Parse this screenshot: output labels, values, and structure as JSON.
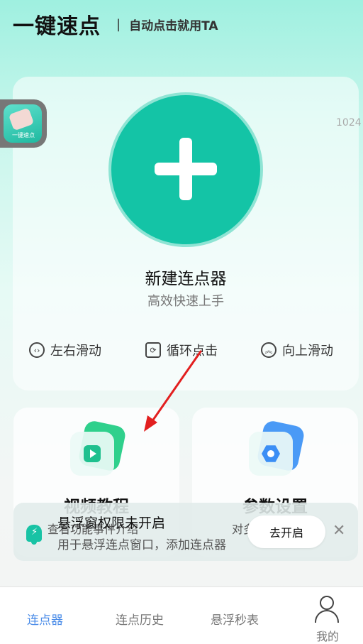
{
  "header": {
    "app_title": "一键速点",
    "separator": "|",
    "slogan": "自动点击就用TA"
  },
  "floating_app": {
    "label": "一键速点"
  },
  "counter_text": "1024",
  "main_card": {
    "new_button_icon": "plus-icon",
    "title": "新建连点器",
    "subtitle": "高效快速上手",
    "modes": [
      {
        "label": "左右滑动",
        "icon": "swap-horizontal-icon"
      },
      {
        "label": "循环点击",
        "icon": "loop-icon"
      },
      {
        "label": "向上滑动",
        "icon": "double-chevron-up-icon"
      }
    ]
  },
  "cards": {
    "video": {
      "title": "视频教程",
      "icon": "play-icon",
      "colors": {
        "back": "#2fd08c",
        "front": "#1fc08e"
      }
    },
    "params": {
      "title": "参数设置",
      "icon": "gear-hex-icon",
      "colors": {
        "back": "#4a9af6",
        "front": "#3b8ef5"
      }
    }
  },
  "toast": {
    "partial_text_left": "查看功能事件介绍",
    "partial_text_right": "对多",
    "title": "悬浮窗权限未开启",
    "desc": "用于悬浮连点窗口，添加连点器",
    "button": "去开启",
    "close": "✕"
  },
  "tabs": [
    {
      "label": "连点器",
      "active": true
    },
    {
      "label": "连点历史",
      "active": false
    },
    {
      "label": "悬浮秒表",
      "active": false
    },
    {
      "label": "我的",
      "active": false
    }
  ],
  "colors": {
    "accent": "#14c4a6",
    "tab_active": "#4b8ce8",
    "arrow": "#e21f1f"
  }
}
